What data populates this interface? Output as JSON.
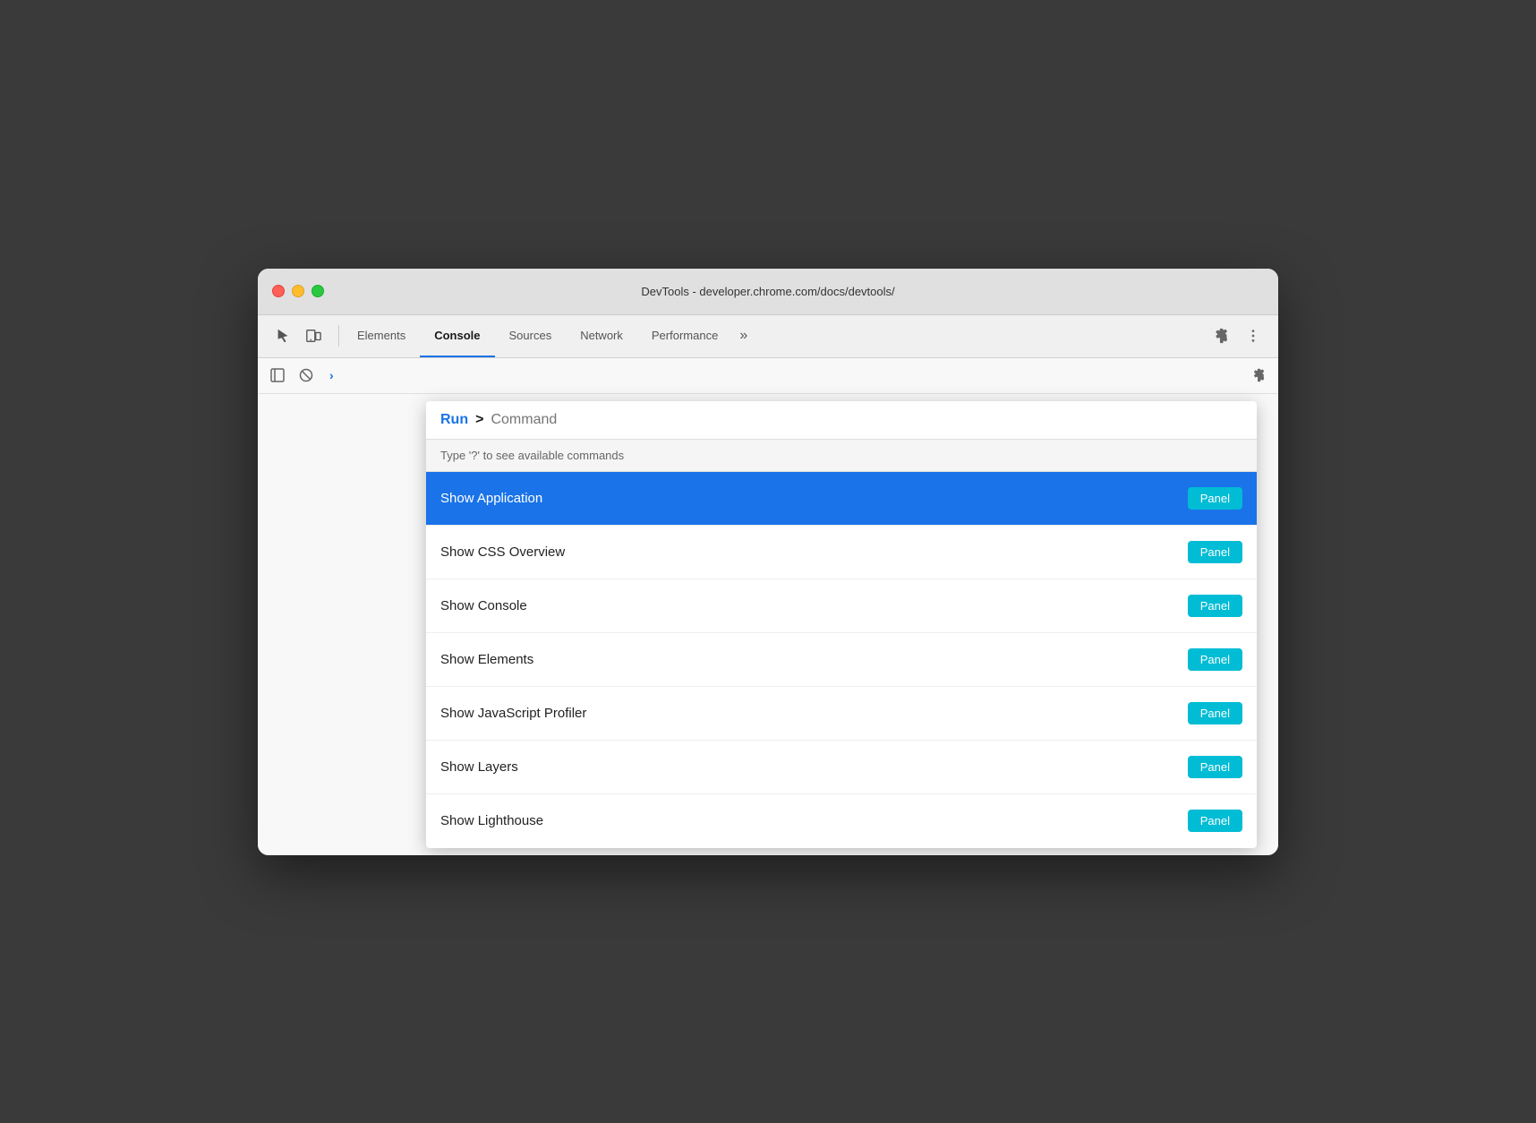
{
  "window": {
    "title": "DevTools - developer.chrome.com/docs/devtools/"
  },
  "titlebar": {
    "close_label": "",
    "minimize_label": "",
    "maximize_label": ""
  },
  "tabs": {
    "items": [
      {
        "id": "elements",
        "label": "Elements",
        "active": false
      },
      {
        "id": "console",
        "label": "Console",
        "active": true
      },
      {
        "id": "sources",
        "label": "Sources",
        "active": false
      },
      {
        "id": "network",
        "label": "Network",
        "active": false
      },
      {
        "id": "performance",
        "label": "Performance",
        "active": false
      }
    ],
    "overflow_label": "»"
  },
  "command_palette": {
    "run_label": "Run",
    "prompt_symbol": ">",
    "input_placeholder": "Command",
    "hint_text": "Type '?' to see available commands",
    "items": [
      {
        "id": "show-application",
        "label": "Show Application",
        "badge": "Panel",
        "active": true
      },
      {
        "id": "show-css-overview",
        "label": "Show CSS Overview",
        "badge": "Panel",
        "active": false
      },
      {
        "id": "show-console",
        "label": "Show Console",
        "badge": "Panel",
        "active": false
      },
      {
        "id": "show-elements",
        "label": "Show Elements",
        "badge": "Panel",
        "active": false
      },
      {
        "id": "show-javascript-profiler",
        "label": "Show JavaScript Profiler",
        "badge": "Panel",
        "active": false
      },
      {
        "id": "show-layers",
        "label": "Show Layers",
        "badge": "Panel",
        "active": false
      },
      {
        "id": "show-lighthouse",
        "label": "Show Lighthouse",
        "badge": "Panel",
        "active": false
      }
    ]
  },
  "colors": {
    "active_tab_indicator": "#1a73e8",
    "active_item_bg": "#1a73e8",
    "panel_badge_bg": "#00bcd4",
    "run_label_color": "#1a73e8"
  }
}
